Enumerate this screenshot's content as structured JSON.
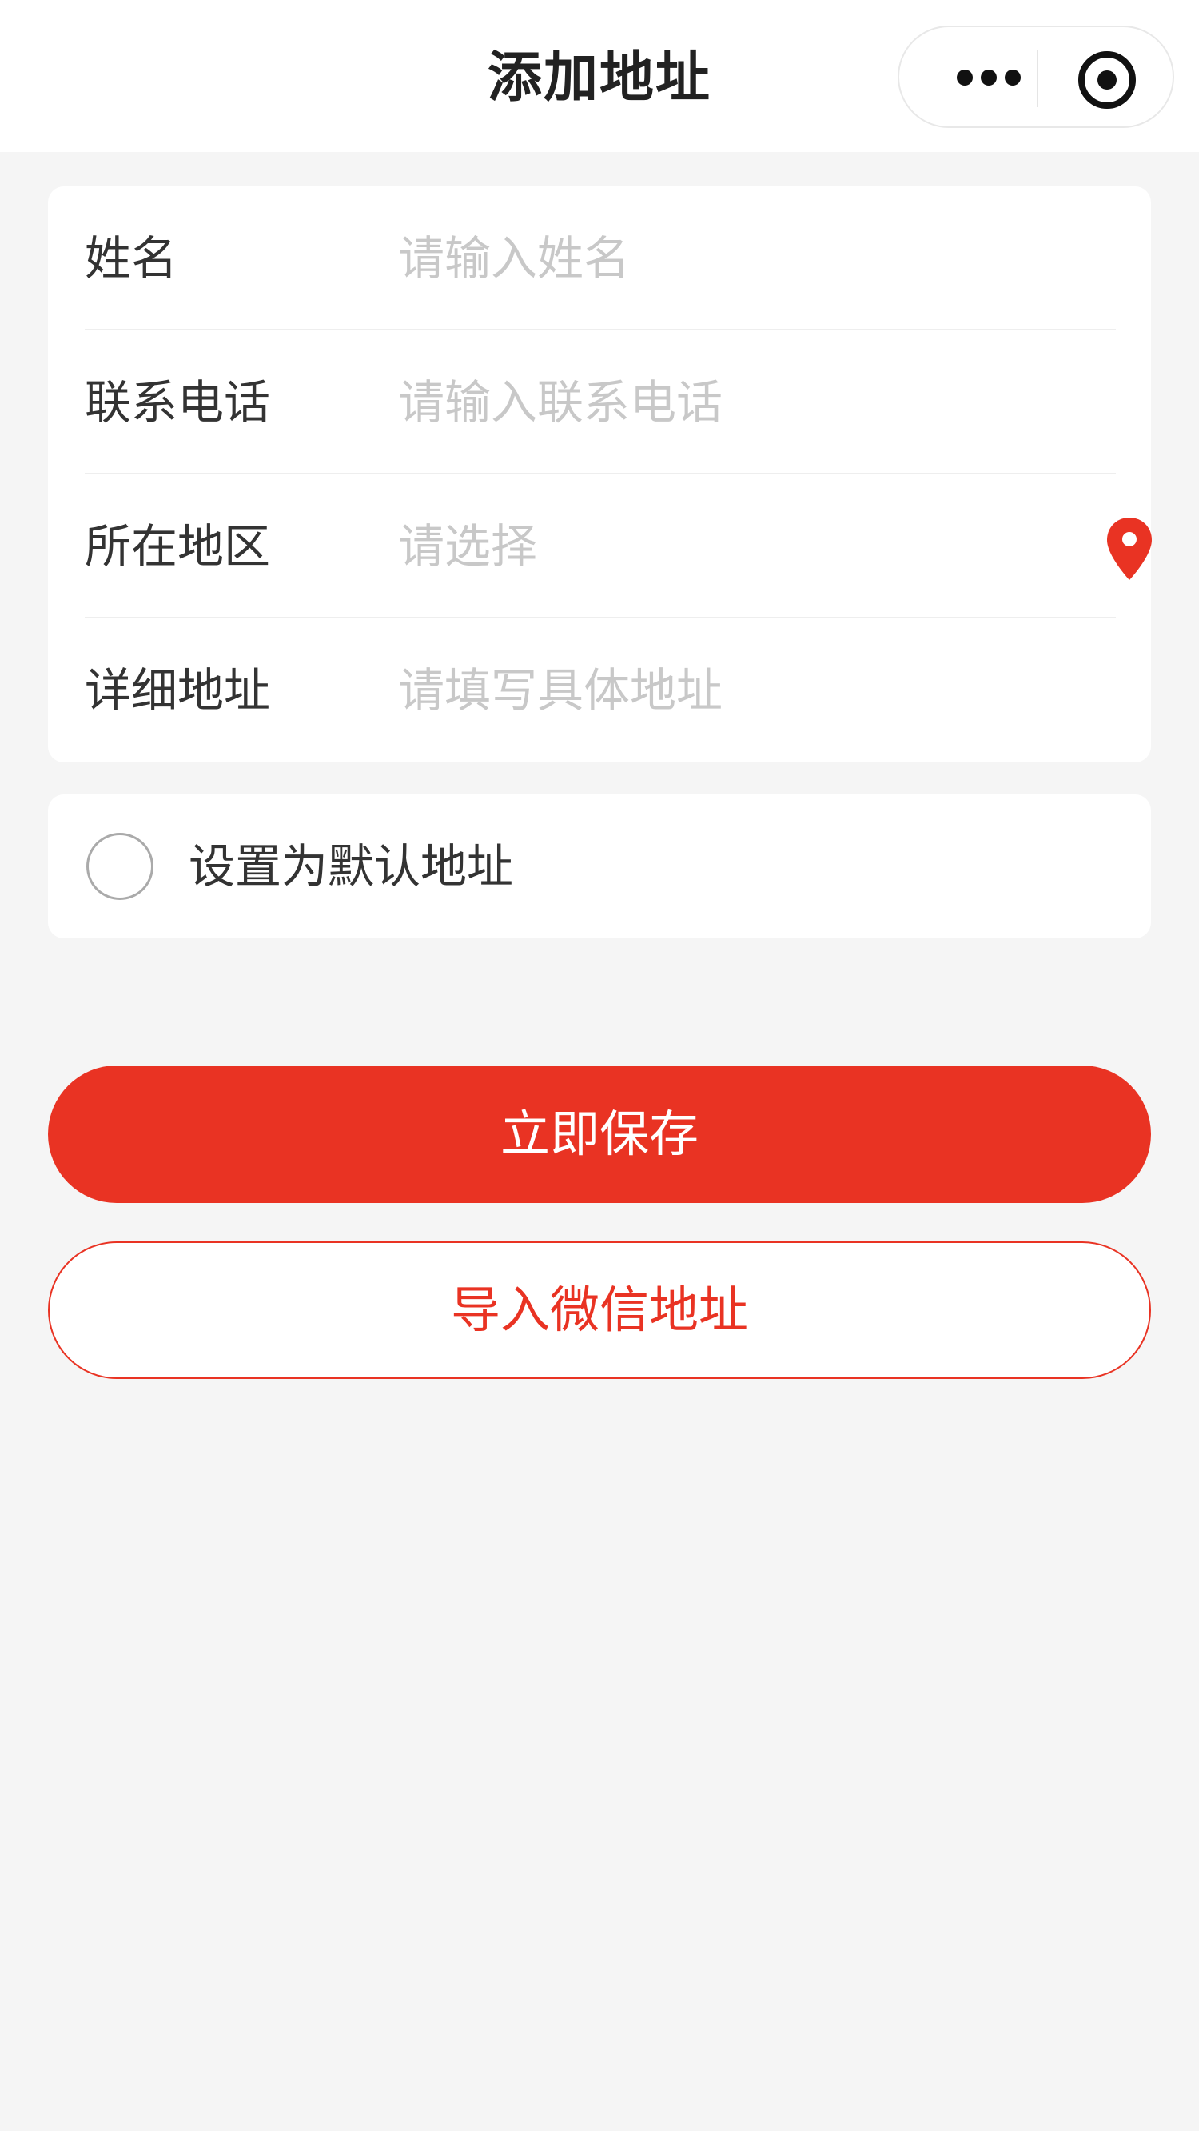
{
  "header": {
    "title": "添加地址",
    "menu_icon": "more-dots-icon",
    "close_icon": "target-icon"
  },
  "form": {
    "name": {
      "label": "姓名",
      "placeholder": "请输入姓名",
      "value": ""
    },
    "phone": {
      "label": "联系电话",
      "placeholder": "请输入联系电话",
      "value": ""
    },
    "region": {
      "label": "所在地区",
      "placeholder": "请选择",
      "value": "",
      "icon": "location-pin-icon"
    },
    "detail": {
      "label": "详细地址",
      "placeholder": "请填写具体地址",
      "value": ""
    }
  },
  "default_address": {
    "label": "设置为默认地址",
    "checked": false
  },
  "buttons": {
    "save_label": "立即保存",
    "import_label": "导入微信地址"
  },
  "colors": {
    "accent": "#e93323",
    "background": "#f5f5f5",
    "card": "#ffffff",
    "placeholder": "#c8c8c8",
    "text": "#333333"
  }
}
